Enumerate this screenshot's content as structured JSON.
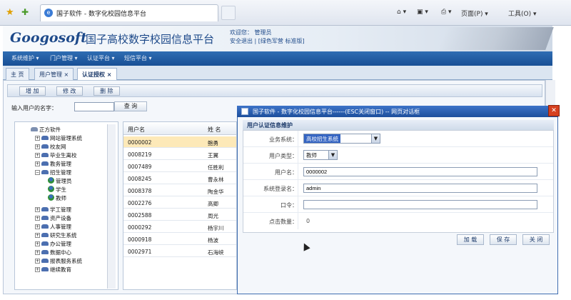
{
  "browser": {
    "tab_title": "国子软件 - 数字化校园信息平台",
    "toolbar": [
      "页面(P) ▾",
      "工具(O) ▾"
    ]
  },
  "header": {
    "logo_en": "Googosoft",
    "logo_cn": "国子高校数字校园信息平台",
    "welcome_line1": "欢迎您：  管理员",
    "welcome_line2": "安全退出 | [绿色军营 标准版]"
  },
  "nav": [
    "系统维护 ▾",
    "门户管理 ▾",
    "认证平台 ▾",
    "短信平台 ▾"
  ],
  "tabs": [
    {
      "label": "主 页"
    },
    {
      "label": "用户管理 ×"
    },
    {
      "label": "认证授权 ×"
    }
  ],
  "toolbar": {
    "add": "增 加",
    "edit": "修 改",
    "delete": "删 除"
  },
  "search": {
    "label": "输入用户的名字：",
    "value": "",
    "button": "查 询"
  },
  "tree": [
    {
      "label": "正方软件",
      "kind": "root"
    },
    {
      "label": "网站管理系统",
      "kind": "folder"
    },
    {
      "label": "校友网",
      "kind": "folder"
    },
    {
      "label": "毕业生离校",
      "kind": "folder"
    },
    {
      "label": "教务管理",
      "kind": "folder"
    },
    {
      "label": "招生管理",
      "kind": "folder-open"
    },
    {
      "label": "管理员",
      "kind": "user"
    },
    {
      "label": "学生",
      "kind": "user"
    },
    {
      "label": "教师",
      "kind": "user"
    },
    {
      "label": "学工管理",
      "kind": "folder"
    },
    {
      "label": "资产设备",
      "kind": "folder"
    },
    {
      "label": "人事管理",
      "kind": "folder"
    },
    {
      "label": "研究生系统",
      "kind": "folder"
    },
    {
      "label": "办公管理",
      "kind": "folder"
    },
    {
      "label": "数据中心",
      "kind": "folder"
    },
    {
      "label": "报表服务系统",
      "kind": "folder"
    },
    {
      "label": "继续教育",
      "kind": "folder"
    }
  ],
  "table": {
    "headers": [
      "用户名",
      "姓 名"
    ],
    "rows": [
      [
        "0000002",
        "鲍勇"
      ],
      [
        "0008219",
        "王翼"
      ],
      [
        "0007489",
        "任胜利"
      ],
      [
        "0008245",
        "曹永林"
      ],
      [
        "0008378",
        "陶金华"
      ],
      [
        "0002276",
        "高卿"
      ],
      [
        "0002588",
        "周光"
      ],
      [
        "0000292",
        "杨宇川"
      ],
      [
        "0000918",
        "杨波"
      ],
      [
        "0002971",
        "石海峡"
      ]
    ]
  },
  "dialog": {
    "title": "国子软件 - 数字化校园信息平台------(ESC关闭窗口) -- 网页对话框",
    "close": "✕",
    "section": "用户认证信息维护",
    "fields": {
      "system_label": "业务系统：",
      "system_value": "高校招生系统",
      "type_label": "用户类型：",
      "type_value": "教师",
      "username_label": "用户名：",
      "username_value": "0000002",
      "login_label": "系统登录名：",
      "login_value": "admin",
      "password_label": "口令：",
      "password_value": "",
      "clicks_label": "点击数量：",
      "clicks_value": "0"
    },
    "buttons": {
      "load": "加 载",
      "save": "保 存",
      "close": "关 闭"
    }
  }
}
